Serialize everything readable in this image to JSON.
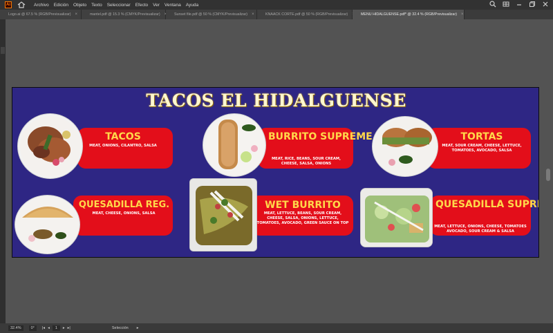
{
  "menubar": {
    "app_icon": "Ai",
    "home_icon": "home-icon",
    "items": [
      "Archivo",
      "Edición",
      "Objeto",
      "Texto",
      "Seleccionar",
      "Efecto",
      "Ver",
      "Ventana",
      "Ayuda"
    ],
    "right_icons": [
      "search-icon",
      "workspace-icon",
      "minimize-icon",
      "restore-icon",
      "close-icon"
    ]
  },
  "tabs": [
    {
      "label": "Logo.ai @ 67.5 % (RGB/Previsualizar)",
      "active": false
    },
    {
      "label": "mantel.pdf @ 15.3 % (CMYK/Previsualizar)",
      "active": false
    },
    {
      "label": "Sunset file.pdf @ 50 % (CMYK/Previsualizar)",
      "active": false
    },
    {
      "label": "KNAACK CORTE.pdf @ 50 % (RGB/Previsualizar)",
      "active": false
    },
    {
      "label": "MENU HIDALGUENSE.pdf* @ 32.4 % (RGB/Previsualizar)",
      "active": true
    }
  ],
  "tab_close": "×",
  "artboard": {
    "title": "TACOS EL HIDALGUENSE",
    "background": "#2e2684",
    "banner_color": "#e30e1a",
    "name_color": "#ffd84a",
    "items": [
      {
        "name": "TACOS",
        "desc": "MEAT, ONIONS, CILANTRO, SALSA"
      },
      {
        "name": "BURRITO SUPREME",
        "desc": "MEAT, RICE, BEANS, SOUR CREAM, CHEESE, SALSA, ONIONS"
      },
      {
        "name": "TORTAS",
        "desc": "MEAT, SOUR CREAM, CHEESE, LETTUCE, TOMATOES, AVOCADO, SALSA"
      },
      {
        "name": "QUESADILLA REG.",
        "desc": "MEAT, CHEESE, ONIONS, SALSA"
      },
      {
        "name": "WET BURRITO",
        "desc": "MEAT, LETTUCE, BEANS, SOUR CREAM, CHEESE, SALSA, ONIONS, LETTUCE, TOMATOES, AVOCADO, GREEN SAUCE ON TOP"
      },
      {
        "name": "QUESADILLA SUPREME",
        "desc": "MEAT, LETTUCE, ONIONS, CHEESE, TOMATOES AVOCADO, SOUR CREAM & SALSA"
      }
    ]
  },
  "statusbar": {
    "zoom": "32.4%",
    "rotation": "0°",
    "page": "1",
    "tool": "Selección",
    "nav_first": "|◂",
    "nav_prev": "◂",
    "nav_next": "▸",
    "nav_last": "▸|",
    "arrow": "▸"
  }
}
